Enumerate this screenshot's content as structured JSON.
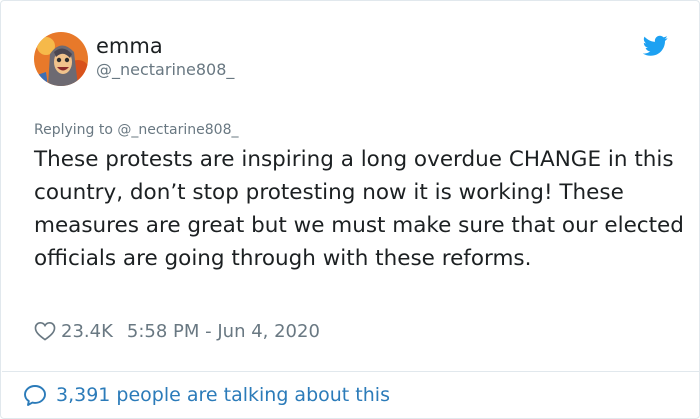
{
  "tweet": {
    "display_name": "emma",
    "handle": "@_nectarine808_",
    "avatar_icon": "cartoon-avatar-icon",
    "brand_icon": "twitter-bird-icon",
    "reply_to": "Replying to @_nectarine808_",
    "text": "These protests are inspiring a long overdue CHANGE in this country, don’t stop protesting now it is working! These measures are great but we must make sure that our elected officials are going through with these reforms.",
    "likes": "23.4K",
    "timestamp": "5:58 PM - Jun 4, 2020",
    "like_icon": "heart-icon"
  },
  "footer": {
    "conversation_icon": "speech-bubble-icon",
    "conversation_text": "3,391 people are talking about this"
  },
  "colors": {
    "brand": "#1da1f2",
    "link": "#2b7bb9",
    "muted": "#697882",
    "text": "#1c2022",
    "border": "#e1e8ed"
  }
}
